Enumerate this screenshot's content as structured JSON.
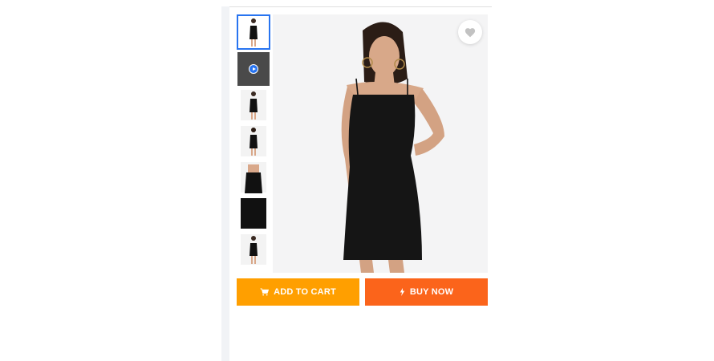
{
  "product": {
    "thumbnails": [
      {
        "kind": "photo",
        "selected": true
      },
      {
        "kind": "video",
        "selected": false
      },
      {
        "kind": "photo",
        "selected": false
      },
      {
        "kind": "photo",
        "selected": false
      },
      {
        "kind": "photo",
        "selected": false
      },
      {
        "kind": "fabric",
        "selected": false
      },
      {
        "kind": "photo",
        "selected": false
      }
    ],
    "wishlist_icon": "heart-icon",
    "actions": {
      "add_to_cart": "ADD TO CART",
      "buy_now": "BUY NOW"
    }
  },
  "colors": {
    "cart": "#ff9f00",
    "buy": "#fb641b",
    "selected_border": "#2874f0"
  }
}
